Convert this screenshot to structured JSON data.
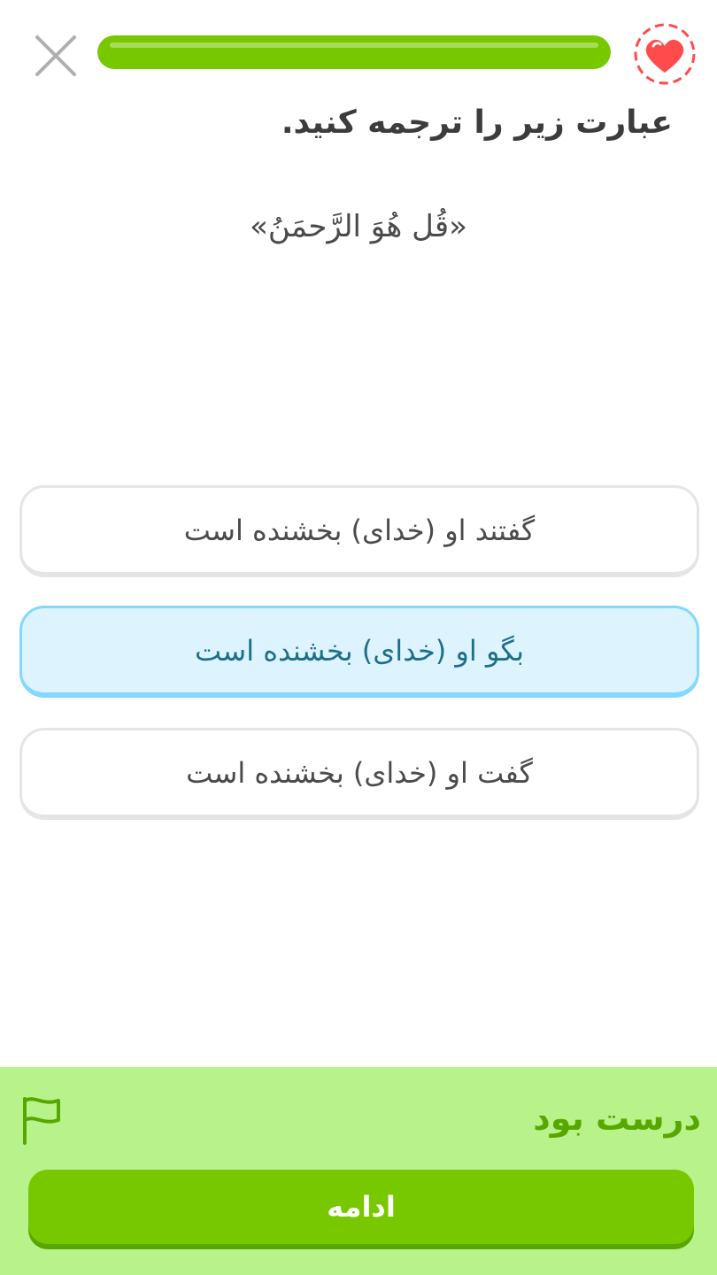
{
  "header": {
    "close_icon": "close-icon",
    "progress": 1.0,
    "progress_color": "#78c800",
    "hearts_icon": "heart-icon",
    "hearts_color": "#ff4b4b"
  },
  "instruction": "عبارت زیر را ترجمه کنید.",
  "prompt": "«قُل هُوَ الرَّحمَنُ»",
  "options": [
    {
      "label": "گفتند او (خدای) بخشنده است",
      "selected": false
    },
    {
      "label": "بگو او (خدای) بخشنده است",
      "selected": true
    },
    {
      "label": "گفت او (خدای) بخشنده است",
      "selected": false
    }
  ],
  "feedback": {
    "title": "درست بود",
    "flag_icon": "flag-icon",
    "continue_label": "ادامه",
    "background": "#b8f28b",
    "accent": "#58a700"
  }
}
